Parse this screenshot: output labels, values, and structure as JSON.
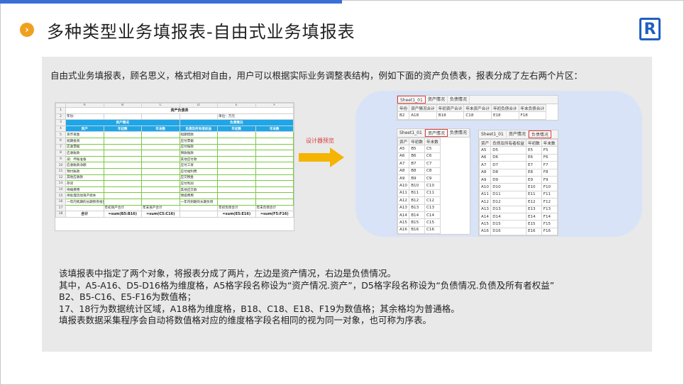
{
  "header": {
    "title": "多种类型业务填报表-自由式业务填报表",
    "bullet_glyph": "›",
    "logo_glyph": "R"
  },
  "intro": "自由式业务填报表，顾名思义，格式相对自由，用户可以根据实际业务调整表结构，例如下面的资产负债表，报表分成了左右两个片区：",
  "sheet": {
    "columns": [
      "A",
      "B",
      "C",
      "D",
      "E",
      "F"
    ],
    "title": "资产负债表",
    "year_label": "年份:",
    "unit_label": "单位：万元",
    "asset_section": "资产情况",
    "liab_section": "负债情况",
    "head_row": [
      "资产",
      "年初数",
      "年末数",
      "负债及所有者权益",
      "年初数",
      "年末数"
    ],
    "rows": [
      [
        "货币资金",
        "短期借款"
      ],
      [
        "短期投资",
        "应付票据"
      ],
      [
        "应收票据",
        "应付账款"
      ],
      [
        "应收账款",
        "预收账款"
      ],
      [
        "减：坏账准备",
        "其他应付款"
      ],
      [
        "应收账款净额",
        "应付工资"
      ],
      [
        "预付账款",
        "应付福利费"
      ],
      [
        "其他应收款",
        "应交税金"
      ],
      [
        "存货",
        "应付利润"
      ],
      [
        "待摊费用",
        "其他应交款"
      ],
      [
        "待处理流动资产损失",
        "预提费用"
      ],
      [
        "一年内到期的长期债券投资",
        "一年内到期的长期负债"
      ]
    ],
    "row17": [
      "",
      "年初资产合计",
      "年末资产合计",
      "",
      "年初负债合计",
      "年末负债合计"
    ],
    "row18": [
      "合计",
      "=sum(B5:B16)",
      "=sum(C5:C16)",
      "",
      "=sum(E5:E16)",
      "=sum(F5:F16)"
    ]
  },
  "preview_label": "设计器预览",
  "preview_top": {
    "tabs": [
      "Sheet1_01",
      "资产情况",
      "负债情况"
    ],
    "head": [
      "年份",
      "资产情况合计",
      "年初资产合计",
      "年末资产合计",
      "年初负债合计",
      "年末负债合计"
    ],
    "row": [
      "B2",
      "A18",
      "B18",
      "C18",
      "E18",
      "F18"
    ]
  },
  "preview_left": {
    "tabs": [
      "Sheet1_01",
      "资产情况",
      "负债情况"
    ],
    "head": [
      "资产",
      "年初数",
      "年末数"
    ],
    "rows": [
      [
        "A5",
        "B5",
        "C5"
      ],
      [
        "A6",
        "B6",
        "C6"
      ],
      [
        "A7",
        "B7",
        "C7"
      ],
      [
        "A8",
        "B8",
        "C8"
      ],
      [
        "A9",
        "B9",
        "C9"
      ],
      [
        "A10",
        "B10",
        "C10"
      ],
      [
        "A11",
        "B11",
        "C11"
      ],
      [
        "A12",
        "B12",
        "C12"
      ],
      [
        "A13",
        "B13",
        "C13"
      ],
      [
        "A14",
        "B14",
        "C14"
      ],
      [
        "A15",
        "B15",
        "C15"
      ],
      [
        "A16",
        "B16",
        "C16"
      ]
    ]
  },
  "preview_right": {
    "tabs": [
      "Sheet1_01",
      "资产情况",
      "负债情况"
    ],
    "head": [
      "资产",
      "负债及所有者权益",
      "年初数",
      "年末数"
    ],
    "rows": [
      [
        "A5",
        "D5",
        "E5",
        "F5"
      ],
      [
        "A6",
        "D6",
        "E6",
        "F6"
      ],
      [
        "A7",
        "D7",
        "E7",
        "F7"
      ],
      [
        "A8",
        "D8",
        "E8",
        "F8"
      ],
      [
        "A9",
        "D9",
        "E9",
        "F9"
      ],
      [
        "A10",
        "D10",
        "E10",
        "F10"
      ],
      [
        "A11",
        "D11",
        "E11",
        "F11"
      ],
      [
        "A12",
        "D12",
        "E12",
        "F12"
      ],
      [
        "A13",
        "D13",
        "E13",
        "F13"
      ],
      [
        "A14",
        "D14",
        "E14",
        "F14"
      ],
      [
        "A15",
        "D15",
        "E15",
        "F15"
      ],
      [
        "A16",
        "D16",
        "E16",
        "F16"
      ]
    ]
  },
  "bottom": [
    "该填报表中指定了两个对象，将报表分成了两片，左边是资产情况，右边是负债情况。",
    "其中，A5-A16、D5-D16格为维度格，A5格字段名称设为“资产情况.资产”，D5格字段名称设为“负债情况.负债及所有者权益”",
    "B2、B5-C16、E5-F16为数值格；",
    "17、18行为数据统计区域，A18格为维度格，B18、C18、E18、F19为数值格；其余格均为普通格。",
    "填报表数据采集程序会自动将数值格对应的维度格字段名相同的视为同一对象，也可称为序表。"
  ]
}
